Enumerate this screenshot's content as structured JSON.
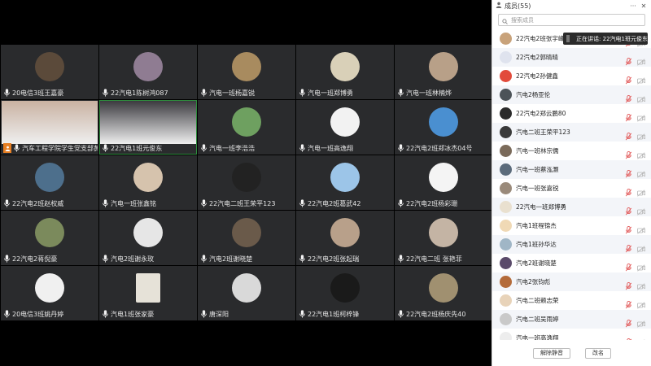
{
  "panel": {
    "title": "成员(55)",
    "search_placeholder": "搜索成员",
    "speaking_tip": "正在讲话: 22汽电1班元俊东",
    "mute_all_label": "解除静音",
    "rename_label": "改名",
    "members": [
      {
        "name": "22汽电2班张宇峰",
        "color": "#c8a27a"
      },
      {
        "name": "22汽电2郭晴晴",
        "color": "#dfe3ee"
      },
      {
        "name": "22汽电2孙健鑫",
        "color": "#e24b3b"
      },
      {
        "name": "汽电2杨亚伦",
        "color": "#4c5358"
      },
      {
        "name": "22汽电2郑云鹏80",
        "color": "#2b2b2b"
      },
      {
        "name": "汽电二班王荣平123",
        "color": "#3a3a3a"
      },
      {
        "name": "汽电一班林宗儒",
        "color": "#7a6a5a"
      },
      {
        "name": "汽电一班蔡泓灏",
        "color": "#5b6b7b"
      },
      {
        "name": "汽电一班张嘉锐",
        "color": "#9a8a7a"
      },
      {
        "name": "22汽电一班郑博勇",
        "color": "#e9e0cf"
      },
      {
        "name": "汽电1班程锦杰",
        "color": "#f0d9b5"
      },
      {
        "name": "汽电1班孙华达",
        "color": "#a0b6c6"
      },
      {
        "name": "汽电2班谢晓楚",
        "color": "#5a4a6a"
      },
      {
        "name": "汽电2张钧彪",
        "color": "#b46b3a"
      },
      {
        "name": "汽电二班赖志荣",
        "color": "#e8d3b9"
      },
      {
        "name": "汽电二班吴雨婷",
        "color": "#c9c9c9"
      },
      {
        "name": "汽电一班高逸翔",
        "color": "#ededed"
      }
    ]
  },
  "tiles": [
    {
      "name": "20电信3班王嘉豪",
      "color": "#5b4a3a",
      "mic": true
    },
    {
      "name": "22汽电1陈树鸿087",
      "color": "#8f7c92",
      "mic": true
    },
    {
      "name": "汽电一班杨嘉锐",
      "color": "#a88b5f",
      "mic": true
    },
    {
      "name": "汽电一班郑博勇",
      "color": "#d9d0b8",
      "mic": true
    },
    {
      "name": "汽电一班林楠烨",
      "color": "#b8a088",
      "mic": true
    },
    {
      "name": "汽车工程学院学生党支部黄安妮",
      "color": "#c9b2a2",
      "mic": false,
      "host": true,
      "video": true
    },
    {
      "name": "22汽电1班元俊东",
      "color": "#3b3a3f",
      "mic": false,
      "speaking": true,
      "video": true
    },
    {
      "name": "汽电一班李浩浩",
      "color": "#6ea060",
      "mic": true
    },
    {
      "name": "汽电一班高逸翔",
      "color": "#f2f2f2",
      "mic": true
    },
    {
      "name": "22汽电2班郑冰杰04号",
      "color": "#4a8fd0",
      "mic": true
    },
    {
      "name": "22汽电2班赵权威",
      "color": "#4d6f8c",
      "mic": true
    },
    {
      "name": "汽电一班张鑫铭",
      "color": "#d6c3ad",
      "mic": true
    },
    {
      "name": "22汽电二班王荣平123",
      "color": "#222222",
      "mic": true
    },
    {
      "name": "22汽电2班葛武42",
      "color": "#9cc5e8",
      "mic": true
    },
    {
      "name": "22汽电2班杨彩珊",
      "color": "#f4f4f4",
      "mic": true
    },
    {
      "name": "22汽电2蒋倪豪",
      "color": "#7b8a5c",
      "mic": true
    },
    {
      "name": "汽电2班谢永玫",
      "color": "#e6e6e6",
      "mic": true
    },
    {
      "name": "汽电2班谢晓楚",
      "color": "#6a5a4a",
      "mic": true
    },
    {
      "name": "22汽电2班张起瑞",
      "color": "#b8a08a",
      "mic": true
    },
    {
      "name": "22汽电二班 张艳菲",
      "color": "#c4b4a4",
      "mic": true
    },
    {
      "name": "20电信3班姚丹婷",
      "color": "#f0f0f0",
      "mic": true
    },
    {
      "name": "汽电1班张家豪",
      "color": "#e6e2d8",
      "mic": true,
      "square": true
    },
    {
      "name": "唐深阳",
      "color": "#d9d9d9",
      "mic": true
    },
    {
      "name": "22汽电1班柯梓锋",
      "color": "#1a1a1a",
      "mic": true
    },
    {
      "name": "22汽电2班杨庆先40",
      "color": "#a09070",
      "mic": true
    }
  ]
}
